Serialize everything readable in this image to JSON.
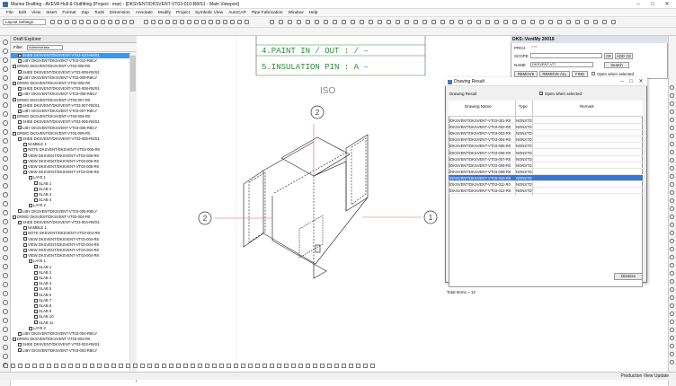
{
  "window": {
    "title": "Marine Drafting - AVEVA Hull & Outfitting (Project : mar) - [DKSVENT/DKSVENT-VT03-010-R8/S1 - Main Viewport]",
    "min": "–",
    "max": "□",
    "close": "✕"
  },
  "menu": [
    "File",
    "Edit",
    "View",
    "Insert",
    "Format",
    "Zap",
    "Tools",
    "Dimension",
    "Annotate",
    "Modify",
    "Project",
    "Symbolic View",
    "AutoCAP",
    "Pipe Fabrication",
    "Window",
    "Help"
  ],
  "toolbar": {
    "layout_combo": "Layout Settings"
  },
  "draft_explorer": {
    "title": "Draft Explorer",
    "filter_label": "Filter",
    "filter_value": "Administrator",
    "items": [
      {
        "text": "SHEE DKSVENT/DKSVENT-VT03-010-R8/S1",
        "indent": 8,
        "sel": true
      },
      {
        "text": "LIBY DKSVENT/DKSVENT-VT03-010-R8/LY",
        "indent": 8
      },
      {
        "text": "DRWG DKSVENT/DKSVENT-VT03-009-R0",
        "indent": 2
      },
      {
        "text": "SHEE DKSVENT/DKSVENT-VT03-009-R8/S1",
        "indent": 8
      },
      {
        "text": "LIBY DKSVENT/DKSVENT-VT03-009-R8/LY",
        "indent": 8
      },
      {
        "text": "DRWG DKSVENT/DKSVENT-VT03-008-R0",
        "indent": 2
      },
      {
        "text": "SHEE DKSVENT/DKSVENT-VT03-008-R8/S1",
        "indent": 8
      },
      {
        "text": "LIBY DKSVENT/DKSVENT-VT03-008-R8/LY",
        "indent": 8
      },
      {
        "text": "DRWG DKSVENT/DKSVENT-VT03-007-R0",
        "indent": 2
      },
      {
        "text": "SHEE DKSVENT/DKSVENT-VT03-007-R8/S1",
        "indent": 8
      },
      {
        "text": "LIBY DKSVENT/DKSVENT-VT03-007-R8/LY",
        "indent": 8
      },
      {
        "text": "DRWG DKSVENT/DKSVENT-VT03-006-R0",
        "indent": 2
      },
      {
        "text": "SHEE DKSVENT/DKSVENT-VT03-006-R8/S1",
        "indent": 8
      },
      {
        "text": "LIBY DKSVENT/DKSVENT-VT03-006-R8/LY",
        "indent": 8
      },
      {
        "text": "DRWG DKSVENT/DKSVENT-VT03-005-R0",
        "indent": 2
      },
      {
        "text": "SHEE DKSVENT/DKSVENT-VT03-005-R8/S1",
        "indent": 8
      },
      {
        "text": "NAMBLE 1",
        "indent": 14
      },
      {
        "text": "NOTE DKSVENT/DKSVENT-VT03-005-R8",
        "indent": 14
      },
      {
        "text": "VIEW DKSVENT/DKSVENT-VT03-005-R8",
        "indent": 14
      },
      {
        "text": "VIEW DKSVENT/DKSVENT-VT03-005-R8",
        "indent": 14
      },
      {
        "text": "VIEW DKSVENT/DKSVENT-VT03-005-R8",
        "indent": 14
      },
      {
        "text": "VIEW DKSVENT/DKSVENT-VT03-005-R8",
        "indent": 14
      },
      {
        "text": "LAYE 1",
        "indent": 20
      },
      {
        "text": "SLAB 1",
        "indent": 26
      },
      {
        "text": "SLAB 2",
        "indent": 26
      },
      {
        "text": "SLAB 3",
        "indent": 26
      },
      {
        "text": "SLAB 4",
        "indent": 26
      },
      {
        "text": "LAYE 2",
        "indent": 20
      },
      {
        "text": "LIBY DKSVENT/DKSVENT-VT03-005-R8/LY",
        "indent": 8
      },
      {
        "text": "DRWG DKSVENT/DKSVENT-VT03-004-R0",
        "indent": 2
      },
      {
        "text": "SHEE DKSVENT/DKSVENT-VT03-004-R8/S1",
        "indent": 8
      },
      {
        "text": "NAMBLE 1",
        "indent": 14
      },
      {
        "text": "NOTE DKSVENT/DKSVENT-VT03-004-R8",
        "indent": 14
      },
      {
        "text": "VIEW DKSVENT/DKSVENT-VT03-004-R8",
        "indent": 14
      },
      {
        "text": "VIEW DKSVENT/DKSVENT-VT03-004-R8",
        "indent": 14
      },
      {
        "text": "VIEW DKSVENT/DKSVENT-VT03-004-R8",
        "indent": 14
      },
      {
        "text": "VIEW DKSVENT/DKSVENT-VT03-004-R8",
        "indent": 14
      },
      {
        "text": "LAYE 1",
        "indent": 20
      },
      {
        "text": "SLAB 1",
        "indent": 26
      },
      {
        "text": "SLAB 2",
        "indent": 26
      },
      {
        "text": "SLAB 3",
        "indent": 26
      },
      {
        "text": "SLAB 4",
        "indent": 26
      },
      {
        "text": "SLAB 5",
        "indent": 26
      },
      {
        "text": "SLAB 6",
        "indent": 26
      },
      {
        "text": "SLAB 7",
        "indent": 26
      },
      {
        "text": "SLAB 8",
        "indent": 26
      },
      {
        "text": "SLAB 9",
        "indent": 26
      },
      {
        "text": "SLAB 10",
        "indent": 26
      },
      {
        "text": "SLAB 11",
        "indent": 26
      },
      {
        "text": "LAYE 2",
        "indent": 20
      },
      {
        "text": "LIBY DKSVENT/DKSVENT-VT03-004-R8/LY",
        "indent": 8
      },
      {
        "text": "DRWG DKSVENT/DKSVENT-VT03-003-R0",
        "indent": 2
      },
      {
        "text": "SHEE DKSVENT/DKSVENT-VT03-003-R8/S1",
        "indent": 8
      },
      {
        "text": "LIBY DKSVENT/DKSVENT-VT03-003-R8/LY",
        "indent": 8
      }
    ]
  },
  "drawing": {
    "line1": "4.PAINT IN / OUT :   /   –",
    "line2": "5.INSULATION PIN :   A   –",
    "view_label": "ISO",
    "markers": [
      "2",
      "2",
      "1",
      "1"
    ]
  },
  "dks_panel": {
    "title": "DKS::VentMy 20018",
    "proj_label": "PROJ.",
    "proj_value": "mar",
    "scope_label": "SCOPE.",
    "ce_button": "CE",
    "add_ce_button": "ADD CE",
    "name_label": "NAME",
    "name_value": "DKSVENT-VT*",
    "search_button": "Search",
    "remove_button": "REMOVE",
    "remove_all_button": "REMOVE ALL",
    "find_button": "FIND",
    "open_when_selected": "Open when selected"
  },
  "dialog": {
    "title": "Drawing Result",
    "label": "Drawing Result",
    "open_when_selected": "Open when selected",
    "columns": [
      "Drawing Name",
      "Type",
      "Remark"
    ],
    "rows": [
      {
        "name": "/DKSVENT/DKSVENT-VT03-001-R0",
        "type": "NONSTD"
      },
      {
        "name": "/DKSVENT/DKSVENT-VT03-002-R0",
        "type": "NONSTD"
      },
      {
        "name": "/DKSVENT/DKSVENT-VT03-003-R0",
        "type": "NONSTD"
      },
      {
        "name": "/DKSVENT/DKSVENT-VT03-004-R0",
        "type": "NONSTD"
      },
      {
        "name": "/DKSVENT/DKSVENT-VT03-005-R0",
        "type": "NONSTD"
      },
      {
        "name": "/DKSVENT/DKSVENT-VT03-006-R0",
        "type": "NONSTD"
      },
      {
        "name": "/DKSVENT/DKSVENT-VT03-007-R0",
        "type": "NONSTD"
      },
      {
        "name": "/DKSVENT/DKSVENT-VT03-008-R0",
        "type": "NONSTD"
      },
      {
        "name": "/DKSVENT/DKSVENT-VT03-009-R0",
        "type": "NONSTD"
      },
      {
        "name": "/DKSVENT/DKSVENT-VT03-010-R0",
        "type": "NONSTD",
        "sel": true
      },
      {
        "name": "/DKSVENT/DKSVENT-VT03-011-R0",
        "type": "NONSTD"
      },
      {
        "name": "/DKSVENT/DKSVENT-VT03-012-R0",
        "type": "NONSTD"
      }
    ],
    "total": "Total Items = 12",
    "dismiss": "Dismiss"
  },
  "status": {
    "text": "Production View   Update"
  },
  "colors": {
    "selection": "#3399ff",
    "dialog_selection": "#3875d7",
    "drawing_green": "#2e8b3a",
    "panel_head": "#dde2ea"
  }
}
